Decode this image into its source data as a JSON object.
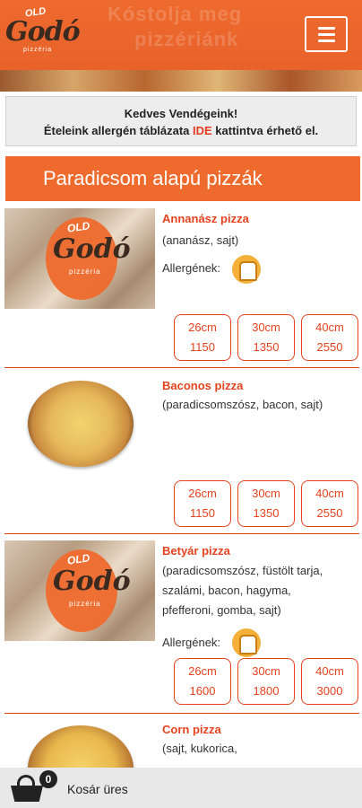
{
  "header": {
    "logo_top": "OLD",
    "logo_main": "Godó",
    "logo_sub": "pizzéria",
    "banner_text_1": "Kóstolja meg",
    "banner_text_2": "pizzériánk"
  },
  "notice": {
    "line1": "Kedves Vendégeink!",
    "line2_before": "Ételeink allergén táblázata ",
    "line2_link": "IDE",
    "line2_after": " kattintva érhető el."
  },
  "category": {
    "title": "Paradicsom alapú pizzák"
  },
  "allergen_label": "Allergének:",
  "items": [
    {
      "name": "Annanász pizza",
      "desc": "(ananász, sajt)",
      "sizes": [
        {
          "size": "26cm",
          "price": "1150"
        },
        {
          "size": "30cm",
          "price": "1350"
        },
        {
          "size": "40cm",
          "price": "2550"
        }
      ]
    },
    {
      "name": "Baconos pizza",
      "desc": "(paradicsomszósz, bacon, sajt)",
      "sizes": [
        {
          "size": "26cm",
          "price": "1150"
        },
        {
          "size": "30cm",
          "price": "1350"
        },
        {
          "size": "40cm",
          "price": "2550"
        }
      ]
    },
    {
      "name": "Betyár pizza",
      "desc1": "(paradicsomszósz, füstölt tarja,",
      "desc2": "szalámi, bacon, hagyma,",
      "desc3": "pfefferoni, gomba, sajt)",
      "sizes": [
        {
          "size": "26cm",
          "price": "1600"
        },
        {
          "size": "30cm",
          "price": "1800"
        },
        {
          "size": "40cm",
          "price": "3000"
        }
      ]
    },
    {
      "name": "Corn pizza",
      "desc": "(sajt, kukorica,"
    }
  ],
  "cart": {
    "count": "0",
    "label": "Kosár üres"
  },
  "colors": {
    "brand": "#ef6a2d",
    "accent_red": "#e5421e",
    "allergen": "#f3b13a"
  }
}
